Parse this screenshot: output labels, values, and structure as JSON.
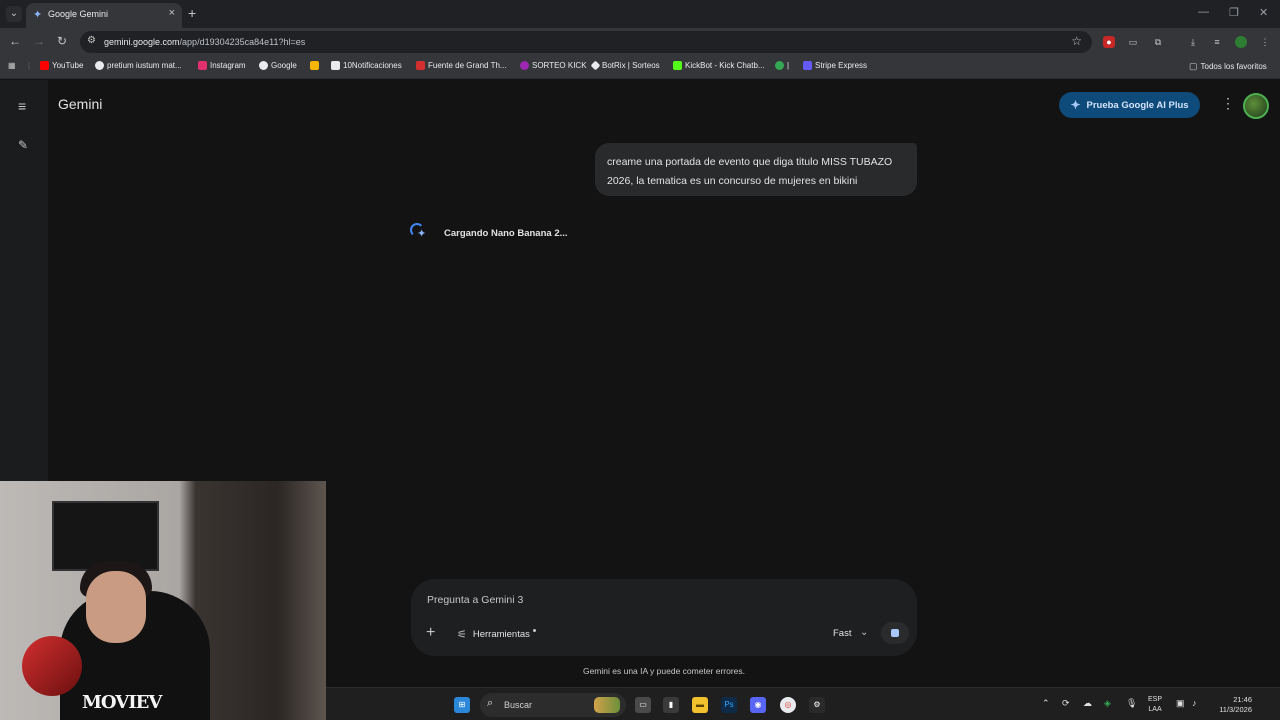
{
  "browser": {
    "tab_title": "Google Gemini",
    "url_host": "gemini.google.com",
    "url_path": "/app/d19304235ca84e11?hl=es",
    "bookmarks": [
      {
        "label": "YouTube",
        "color": "#ff0000"
      },
      {
        "label": "pretium iustum mat...",
        "color": "#e8eaed"
      },
      {
        "label": "Instagram",
        "color": "#e1306c"
      },
      {
        "label": "Google",
        "color": "#4285f4"
      },
      {
        "label": "",
        "color": "#f4b400"
      },
      {
        "label": "10Notificaciones",
        "color": "#e8eaed"
      },
      {
        "label": "Fuente de Grand Th...",
        "color": "#d32f2f"
      },
      {
        "label": "SORTEO KICK",
        "color": "#9c27b0"
      },
      {
        "label": "BotRix | Sorteos",
        "color": "#e8eaed"
      },
      {
        "label": "KickBot - Kick Chatb...",
        "color": "#53fc18"
      },
      {
        "label": "|",
        "color": "#34a853"
      },
      {
        "label": "Stripe Express",
        "color": "#635bff"
      }
    ],
    "all_bookmarks": "Todos los favoritos"
  },
  "gemini": {
    "brand": "Gemini",
    "upgrade_label": "Prueba Google AI Plus",
    "user_message": "creame una portada de evento que diga titulo MISS TUBAZO 2026, la tematica es un concurso de mujeres en bikini",
    "loading_text": "Cargando Nano Banana 2...",
    "input_placeholder": "Pregunta a Gemini 3",
    "tools_label": "Herramientas",
    "mode_label": "Fast",
    "disclaimer": "Gemini es una IA y puede cometer errores."
  },
  "webcam": {
    "shirt_text": "MOVIEV"
  },
  "taskbar": {
    "search_label": "Buscar",
    "lang_top": "ESP",
    "lang_bottom": "LAA",
    "time": "21:46",
    "date": "11/3/2026"
  }
}
